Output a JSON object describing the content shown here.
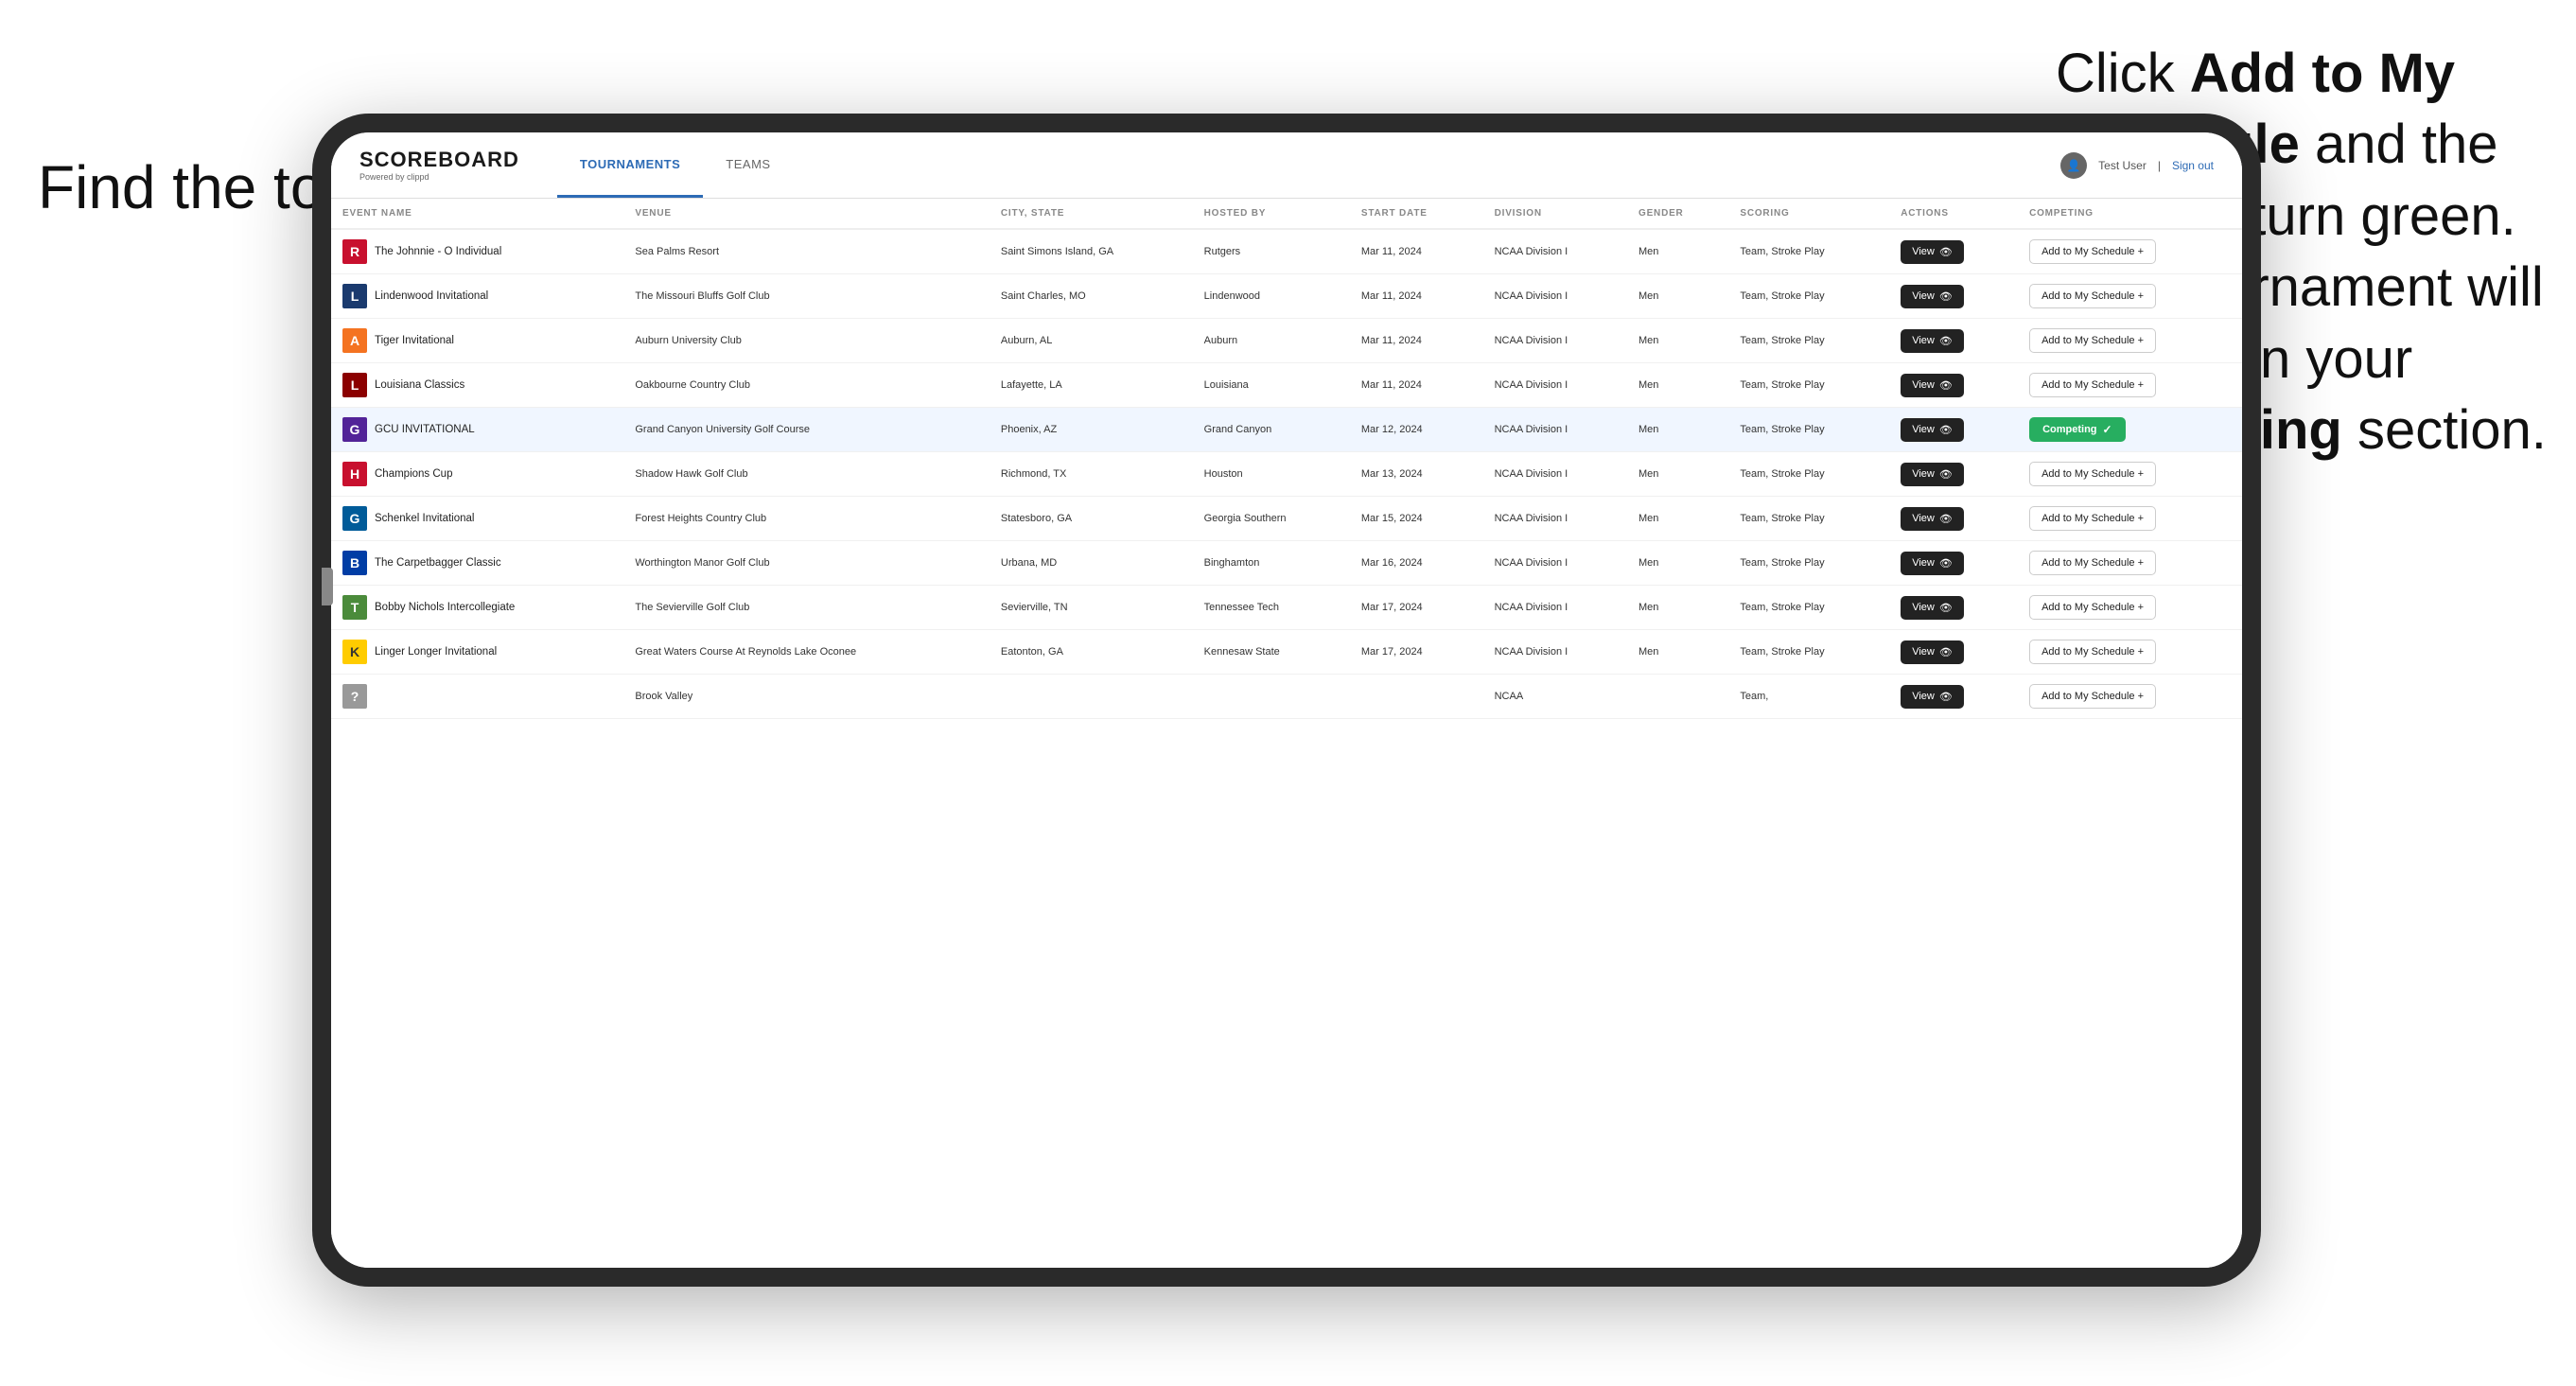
{
  "annotation": {
    "left": "Find the\ntournament.",
    "right_part1": "Click ",
    "right_bold1": "Add to My\nSchedule",
    "right_part2": " and the\nbox will turn green.\nThis tournament\nwill now be in\nyour ",
    "right_bold2": "Competing",
    "right_part3": "\nsection."
  },
  "header": {
    "logo": "SCOREBOARD",
    "logo_sub": "Powered by clippd",
    "nav_tabs": [
      {
        "label": "TOURNAMENTS",
        "active": true
      },
      {
        "label": "TEAMS",
        "active": false
      }
    ],
    "user": "Test User",
    "signout": "Sign out"
  },
  "table": {
    "columns": [
      "EVENT NAME",
      "VENUE",
      "CITY, STATE",
      "HOSTED BY",
      "START DATE",
      "DIVISION",
      "GENDER",
      "SCORING",
      "ACTIONS",
      "COMPETING"
    ],
    "rows": [
      {
        "logo_char": "R",
        "logo_color": "#c8102e",
        "event": "The Johnnie - O Individual",
        "venue": "Sea Palms Resort",
        "city_state": "Saint Simons Island, GA",
        "hosted_by": "Rutgers",
        "start_date": "Mar 11, 2024",
        "division": "NCAA Division I",
        "gender": "Men",
        "scoring": "Team, Stroke Play",
        "action": "view",
        "competing": "add",
        "highlighted": false
      },
      {
        "logo_char": "L",
        "logo_color": "#1a3a6e",
        "event": "Lindenwood Invitational",
        "venue": "The Missouri Bluffs Golf Club",
        "city_state": "Saint Charles, MO",
        "hosted_by": "Lindenwood",
        "start_date": "Mar 11, 2024",
        "division": "NCAA Division I",
        "gender": "Men",
        "scoring": "Team, Stroke Play",
        "action": "view",
        "competing": "add",
        "highlighted": false
      },
      {
        "logo_char": "A",
        "logo_color": "#f47321",
        "event": "Tiger Invitational",
        "venue": "Auburn University Club",
        "city_state": "Auburn, AL",
        "hosted_by": "Auburn",
        "start_date": "Mar 11, 2024",
        "division": "NCAA Division I",
        "gender": "Men",
        "scoring": "Team, Stroke Play",
        "action": "view",
        "competing": "add",
        "highlighted": false
      },
      {
        "logo_char": "L",
        "logo_color": "#8b0000",
        "event": "Louisiana Classics",
        "venue": "Oakbourne Country Club",
        "city_state": "Lafayette, LA",
        "hosted_by": "Louisiana",
        "start_date": "Mar 11, 2024",
        "division": "NCAA Division I",
        "gender": "Men",
        "scoring": "Team, Stroke Play",
        "action": "view",
        "competing": "add",
        "highlighted": false
      },
      {
        "logo_char": "G",
        "logo_color": "#522398",
        "event": "GCU INVITATIONAL",
        "venue": "Grand Canyon University Golf Course",
        "city_state": "Phoenix, AZ",
        "hosted_by": "Grand Canyon",
        "start_date": "Mar 12, 2024",
        "division": "NCAA Division I",
        "gender": "Men",
        "scoring": "Team, Stroke Play",
        "action": "view",
        "competing": "competing",
        "highlighted": true
      },
      {
        "logo_char": "H",
        "logo_color": "#c8102e",
        "event": "Champions Cup",
        "venue": "Shadow Hawk Golf Club",
        "city_state": "Richmond, TX",
        "hosted_by": "Houston",
        "start_date": "Mar 13, 2024",
        "division": "NCAA Division I",
        "gender": "Men",
        "scoring": "Team, Stroke Play",
        "action": "view",
        "competing": "add",
        "highlighted": false
      },
      {
        "logo_char": "G",
        "logo_color": "#005b99",
        "event": "Schenkel Invitational",
        "venue": "Forest Heights Country Club",
        "city_state": "Statesboro, GA",
        "hosted_by": "Georgia Southern",
        "start_date": "Mar 15, 2024",
        "division": "NCAA Division I",
        "gender": "Men",
        "scoring": "Team, Stroke Play",
        "action": "view",
        "competing": "add",
        "highlighted": false
      },
      {
        "logo_char": "B",
        "logo_color": "#003da5",
        "event": "The Carpetbagger Classic",
        "venue": "Worthington Manor Golf Club",
        "city_state": "Urbana, MD",
        "hosted_by": "Binghamton",
        "start_date": "Mar 16, 2024",
        "division": "NCAA Division I",
        "gender": "Men",
        "scoring": "Team, Stroke Play",
        "action": "view",
        "competing": "add",
        "highlighted": false
      },
      {
        "logo_char": "T",
        "logo_color": "#4b8b3b",
        "event": "Bobby Nichols Intercollegiate",
        "venue": "The Sevierville Golf Club",
        "city_state": "Sevierville, TN",
        "hosted_by": "Tennessee Tech",
        "start_date": "Mar 17, 2024",
        "division": "NCAA Division I",
        "gender": "Men",
        "scoring": "Team, Stroke Play",
        "action": "view",
        "competing": "add",
        "highlighted": false
      },
      {
        "logo_char": "K",
        "logo_color": "#ffcc00",
        "event": "Linger Longer Invitational",
        "venue": "Great Waters Course At Reynolds Lake Oconee",
        "city_state": "Eatonton, GA",
        "hosted_by": "Kennesaw State",
        "start_date": "Mar 17, 2024",
        "division": "NCAA Division I",
        "gender": "Men",
        "scoring": "Team, Stroke Play",
        "action": "view",
        "competing": "add",
        "highlighted": false
      },
      {
        "logo_char": "?",
        "logo_color": "#999",
        "event": "",
        "venue": "Brook Valley",
        "city_state": "",
        "hosted_by": "",
        "start_date": "",
        "division": "NCAA",
        "gender": "",
        "scoring": "Team,",
        "action": "view",
        "competing": "add",
        "highlighted": false
      }
    ],
    "btn_labels": {
      "view": "View",
      "add": "Add to My Schedule +",
      "competing": "Competing ✓"
    }
  }
}
